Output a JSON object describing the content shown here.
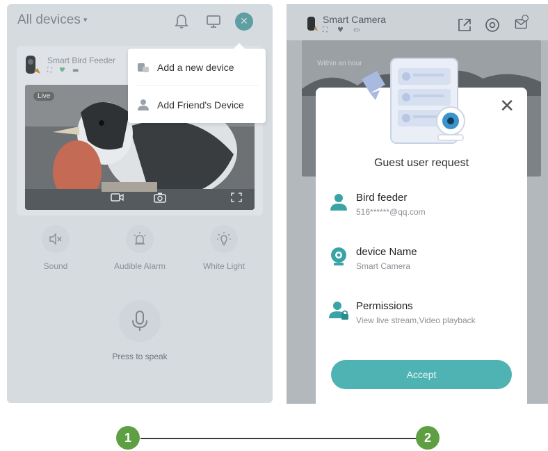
{
  "screen1": {
    "title": "All devices",
    "device": {
      "name": "Smart Bird Feeder",
      "live_label": "Live"
    },
    "menu": {
      "items": [
        {
          "label": "Add a new device",
          "icon": "add-device-icon"
        },
        {
          "label": "Add Friend's Device",
          "icon": "friend-icon"
        }
      ]
    },
    "controls": [
      {
        "label": "Sound",
        "icon": "mute-icon"
      },
      {
        "label": "Audible Alarm",
        "icon": "alarm-icon"
      },
      {
        "label": "White Light",
        "icon": "light-bulb-icon"
      }
    ],
    "speak": {
      "label": "Press to speak"
    }
  },
  "screen2": {
    "title": "Smart Camera",
    "video_overlay": "Within an hour",
    "modal": {
      "title": "Guest user request",
      "rows": [
        {
          "heading": "Bird feeder",
          "sub": "516******@qq.com",
          "icon": "user-icon"
        },
        {
          "heading": "device Name",
          "sub": "Smart Camera",
          "icon": "camera-icon"
        },
        {
          "heading": "Permissions",
          "sub": "View live stream,Video playback",
          "icon": "permission-icon"
        }
      ],
      "accept_label": "Accept"
    }
  },
  "steps": [
    "1",
    "2"
  ],
  "colors": {
    "accent": "#4fb3b4",
    "step_green": "#5d9f42",
    "overlay_gray": "#d6dbe0"
  }
}
